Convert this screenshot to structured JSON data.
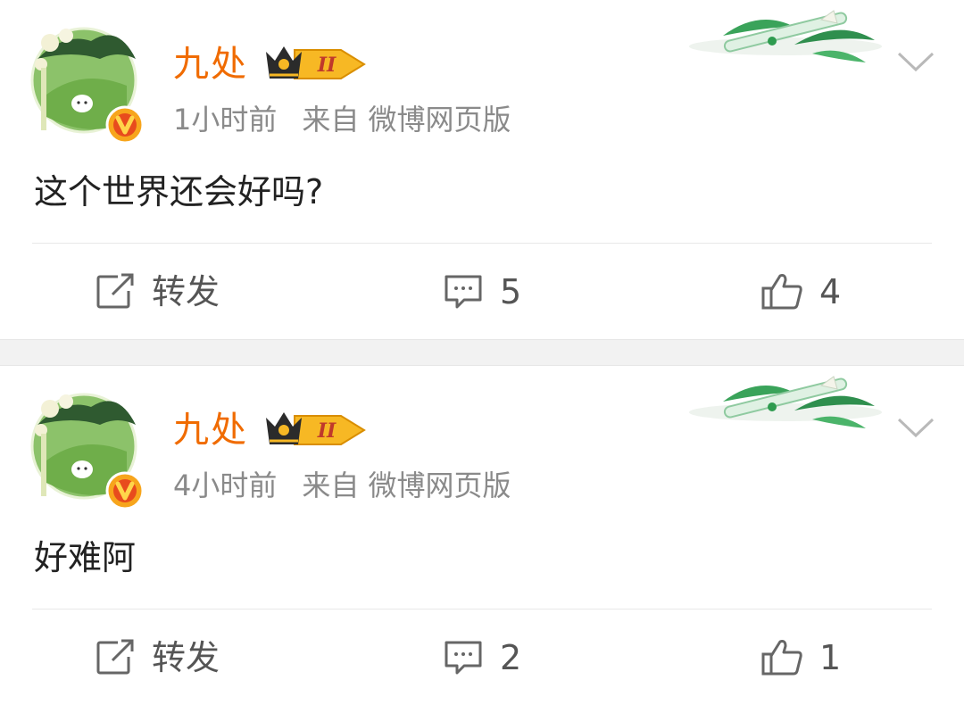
{
  "posts": [
    {
      "username": "九处",
      "vip_level": "II",
      "time": "1小时前",
      "source": "来自 微博网页版",
      "content": "这个世界还会好吗?",
      "actions": {
        "repost_label": "转发",
        "comment_count": "5",
        "like_count": "4"
      }
    },
    {
      "username": "九处",
      "vip_level": "II",
      "time": "4小时前",
      "source": "来自 微博网页版",
      "content": "好难阿",
      "actions": {
        "repost_label": "转发",
        "comment_count": "2",
        "like_count": "1"
      }
    }
  ],
  "icons": {
    "repost": "repost-icon",
    "comment": "comment-icon",
    "like": "like-icon",
    "menu": "chevron-down-icon",
    "verified": "verified-badge-icon",
    "crown": "vip-crown-icon"
  },
  "colors": {
    "username": "#f06b00",
    "meta": "#8a8a8a",
    "icon": "#666666",
    "divider_band": "#f2f2f2"
  }
}
